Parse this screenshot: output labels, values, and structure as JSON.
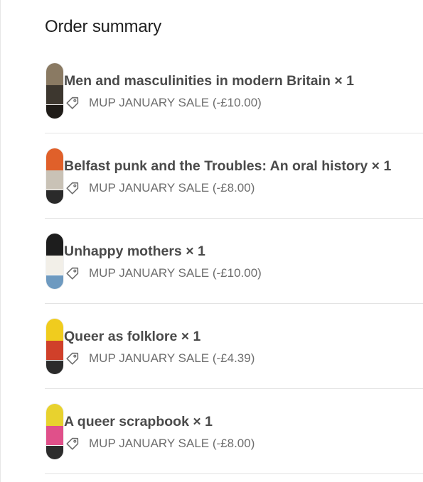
{
  "summary": {
    "title": "Order summary"
  },
  "items": [
    {
      "name": "Men and masculinities in modern Britain",
      "qty": "× 1",
      "discount": "MUP JANUARY SALE (-£10.00)",
      "cover_colors": [
        "#8a7a63",
        "#3d372f",
        "#1f1c18"
      ]
    },
    {
      "name": "Belfast punk and the Troubles: An oral history",
      "qty": "× 1",
      "discount": "MUP JANUARY SALE (-£8.00)",
      "cover_colors": [
        "#e0602a",
        "#c9c2b6",
        "#2a2a2a"
      ]
    },
    {
      "name": "Unhappy mothers",
      "qty": "× 1",
      "discount": "MUP JANUARY SALE (-£10.00)",
      "cover_colors": [
        "#1d1d1d",
        "#f2efe8",
        "#6e9ac0"
      ]
    },
    {
      "name": "Queer as folklore",
      "qty": "× 1",
      "discount": "MUP JANUARY SALE (-£4.39)",
      "cover_colors": [
        "#f0cc1e",
        "#d0402a",
        "#2b2b2b"
      ]
    },
    {
      "name": "A queer scrapbook",
      "qty": "× 1",
      "discount": "MUP JANUARY SALE (-£8.00)",
      "cover_colors": [
        "#e8d22e",
        "#e0508a",
        "#2c2c2c"
      ]
    }
  ],
  "icons": {
    "discount_tag": "tag-icon"
  }
}
